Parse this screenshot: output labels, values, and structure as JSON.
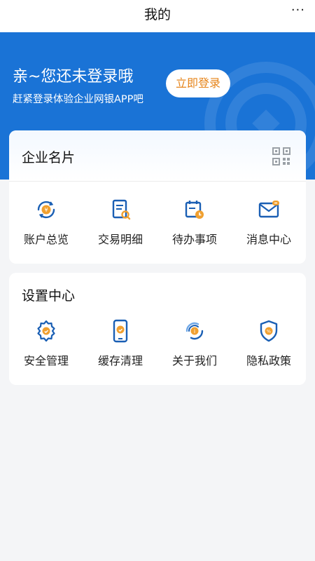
{
  "topbar": {
    "title": "我的",
    "more": "···"
  },
  "hero": {
    "greeting": "亲~您还未登录哦",
    "subtitle": "赶紧登录体验企业网银APP吧",
    "login_label": "立即登录"
  },
  "business_card": {
    "title": "企业名片",
    "items": [
      {
        "label": "账户总览",
        "icon": "account-overview-icon"
      },
      {
        "label": "交易明细",
        "icon": "transaction-detail-icon"
      },
      {
        "label": "待办事项",
        "icon": "todo-icon"
      },
      {
        "label": "消息中心",
        "icon": "message-icon"
      }
    ]
  },
  "settings": {
    "title": "设置中心",
    "items": [
      {
        "label": "安全管理",
        "icon": "security-icon"
      },
      {
        "label": "缓存清理",
        "icon": "cache-clean-icon"
      },
      {
        "label": "关于我们",
        "icon": "about-icon"
      },
      {
        "label": "隐私政策",
        "icon": "privacy-icon"
      }
    ]
  },
  "colors": {
    "brand_blue": "#1a73d6",
    "accent_orange": "#e6841a",
    "background": "#f4f5f7"
  }
}
